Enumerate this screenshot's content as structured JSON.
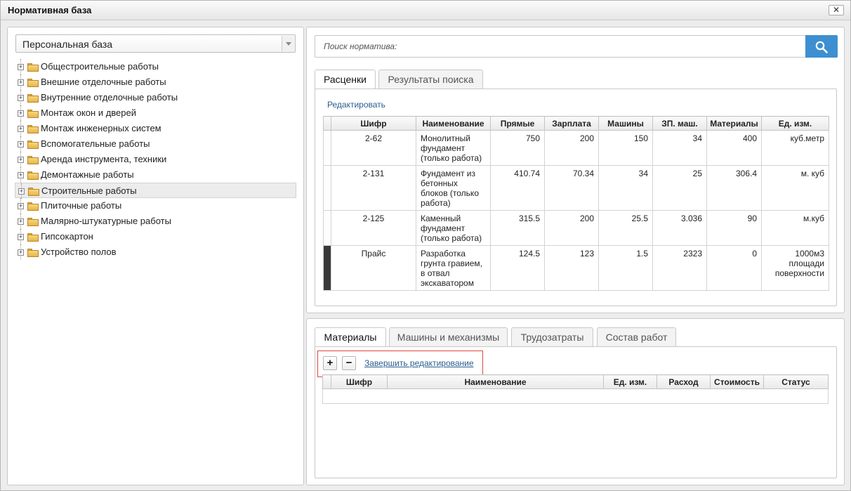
{
  "window": {
    "title": "Нормативная база",
    "close_glyph": "✕"
  },
  "left": {
    "base_select": "Персональная база",
    "tree": [
      {
        "label": "Общестроительные работы"
      },
      {
        "label": "Внешние отделочные работы"
      },
      {
        "label": "Внутренние отделочные работы"
      },
      {
        "label": "Монтаж окон и дверей"
      },
      {
        "label": "Монтаж инженерных систем"
      },
      {
        "label": "Вспомогательные работы"
      },
      {
        "label": "Аренда инструмента, техники"
      },
      {
        "label": "Демонтажные работы"
      },
      {
        "label": "Строительные работы",
        "selected": true
      },
      {
        "label": "Плиточные работы"
      },
      {
        "label": "Малярно-штукатурные работы"
      },
      {
        "label": "Гипсокартон"
      },
      {
        "label": "Устройство полов"
      }
    ]
  },
  "search": {
    "placeholder": "Поиск норматива:",
    "icon": "search-icon"
  },
  "top_tabs": [
    {
      "label": "Расценки",
      "active": true
    },
    {
      "label": "Результаты поиска",
      "active": false
    }
  ],
  "rates": {
    "edit_link": "Редактировать",
    "columns": [
      "Шифр",
      "Наименование",
      "Прямые",
      "Зарплата",
      "Машины",
      "ЗП. маш.",
      "Материалы",
      "Ед. изм."
    ],
    "rows": [
      {
        "code": "2-62",
        "name": "Монолитный фундамент (только работа)",
        "direct": "750",
        "salary": "200",
        "machines": "150",
        "machine_salary": "34",
        "materials": "400",
        "unit": "куб.метр",
        "marked": false
      },
      {
        "code": "2-131",
        "name": "Фундамент из бетонных блоков (только работа)",
        "direct": "410.74",
        "salary": "70.34",
        "machines": "34",
        "machine_salary": "25",
        "materials": "306.4",
        "unit": "м. куб",
        "marked": false
      },
      {
        "code": "2-125",
        "name": "Каменный фундамент (только работа)",
        "direct": "315.5",
        "salary": "200",
        "machines": "25.5",
        "machine_salary": "3.036",
        "materials": "90",
        "unit": "м.куб",
        "marked": false
      },
      {
        "code": "Прайс",
        "name": "Разработка грунта гравием, в отвал экскаватором",
        "direct": "124.5",
        "salary": "123",
        "machines": "1.5",
        "machine_salary": "2323",
        "materials": "0",
        "unit": "1000м3 площади поверхности",
        "marked": true
      }
    ]
  },
  "bottom_tabs": [
    {
      "label": "Материалы",
      "active": true
    },
    {
      "label": "Машины и механизмы",
      "active": false
    },
    {
      "label": "Трудозатраты",
      "active": false
    },
    {
      "label": "Состав работ",
      "active": false
    }
  ],
  "materials": {
    "add_glyph": "+",
    "remove_glyph": "−",
    "finish_link": "Завершить редактирование",
    "columns": [
      "Шифр",
      "Наименование",
      "Ед. изм.",
      "Расход",
      "Стоимость",
      "Статус"
    ]
  },
  "colors": {
    "accent": "#3d8fd1",
    "highlight": "#e0473e",
    "link": "#2a5d8f"
  }
}
